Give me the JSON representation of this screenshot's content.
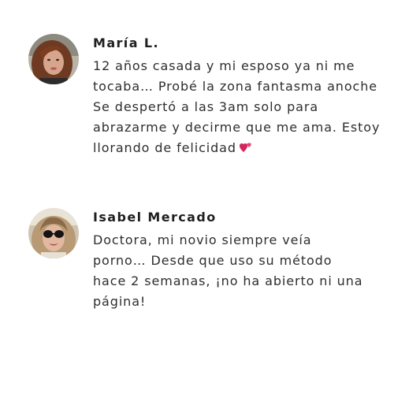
{
  "comments": [
    {
      "author": "María L.",
      "lines": [
        "12 años casada y mi esposo ya ni me",
        "tocaba… Probé la zona fantasma anoche",
        "Se despertó a las 3am solo para",
        "abrazarme y decirme que me ama. Estoy",
        "llorando de felicidad"
      ],
      "emoji": "two-hearts-icon"
    },
    {
      "author": "Isabel Mercado",
      "lines": [
        "Doctora, mi novio siempre veía",
        "porno… Desde que uso su método",
        "hace 2 semanas, ¡no ha abierto ni una",
        "página!"
      ]
    }
  ]
}
